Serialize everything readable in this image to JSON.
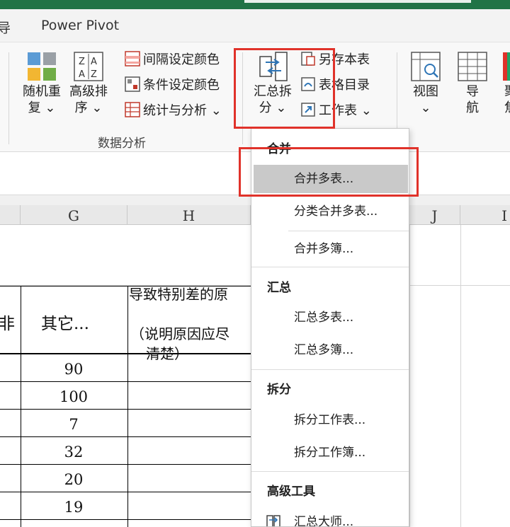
{
  "tabs": {
    "partial_left": "导",
    "power_pivot": "Power Pivot"
  },
  "ribbon": {
    "random_repeat": [
      "随机重",
      "复 ⌄"
    ],
    "advanced_sort": [
      "高级排",
      "序 ⌄"
    ],
    "interval_color": "间隔设定颜色",
    "condition_color": "条件设定颜色",
    "stats_analysis": "统计与分析 ⌄",
    "summarize_split": [
      "汇总拆",
      "分 ⌄"
    ],
    "save_sheet": "另存本表",
    "table_directory": "表格目录",
    "worksheet": "工作表 ⌄",
    "view": [
      "视图",
      "⌄"
    ],
    "navigate": [
      "导",
      "航"
    ],
    "partial_right": [
      "聚",
      "焦"
    ],
    "group_data_analysis": "数据分析"
  },
  "sheet": {
    "col_g": "G",
    "col_h": "H",
    "col_j": "J",
    "col_k_partial": "I",
    "header_partial_left": "非",
    "header_other": "其它...",
    "header_h_line1": "导致特别差的原",
    "header_h_line2": "（说明原因应尽",
    "header_h_line3": "清楚）",
    "g_values": [
      "90",
      "100",
      "7",
      "32",
      "20",
      "19"
    ]
  },
  "dropdown": {
    "merge_header": "合并",
    "merge_multi_sheets": "合并多表...",
    "category_merge_sheets": "分类合并多表...",
    "merge_multi_books": "合并多簿...",
    "summary_header": "汇总",
    "summary_multi_sheets": "汇总多表...",
    "summary_multi_books": "汇总多簿...",
    "split_header": "拆分",
    "split_worksheet": "拆分工作表...",
    "split_workbook": "拆分工作簿...",
    "tools_header": "高级工具",
    "summary_master": "汇总大师..."
  },
  "colors": {
    "excel_green": "#217346",
    "highlight_red": "#e0322a",
    "menu_highlight": "#c9c9c9"
  },
  "icons": [
    "tiles-icon",
    "az-sort-icon",
    "interval-color-icon",
    "condition-color-icon",
    "stats-icon",
    "merge-split-icon",
    "save-copy-icon",
    "table-toc-icon",
    "worksheet-icon",
    "view-icon",
    "navigation-grid-icon",
    "focus-icon",
    "summary-master-icon"
  ]
}
